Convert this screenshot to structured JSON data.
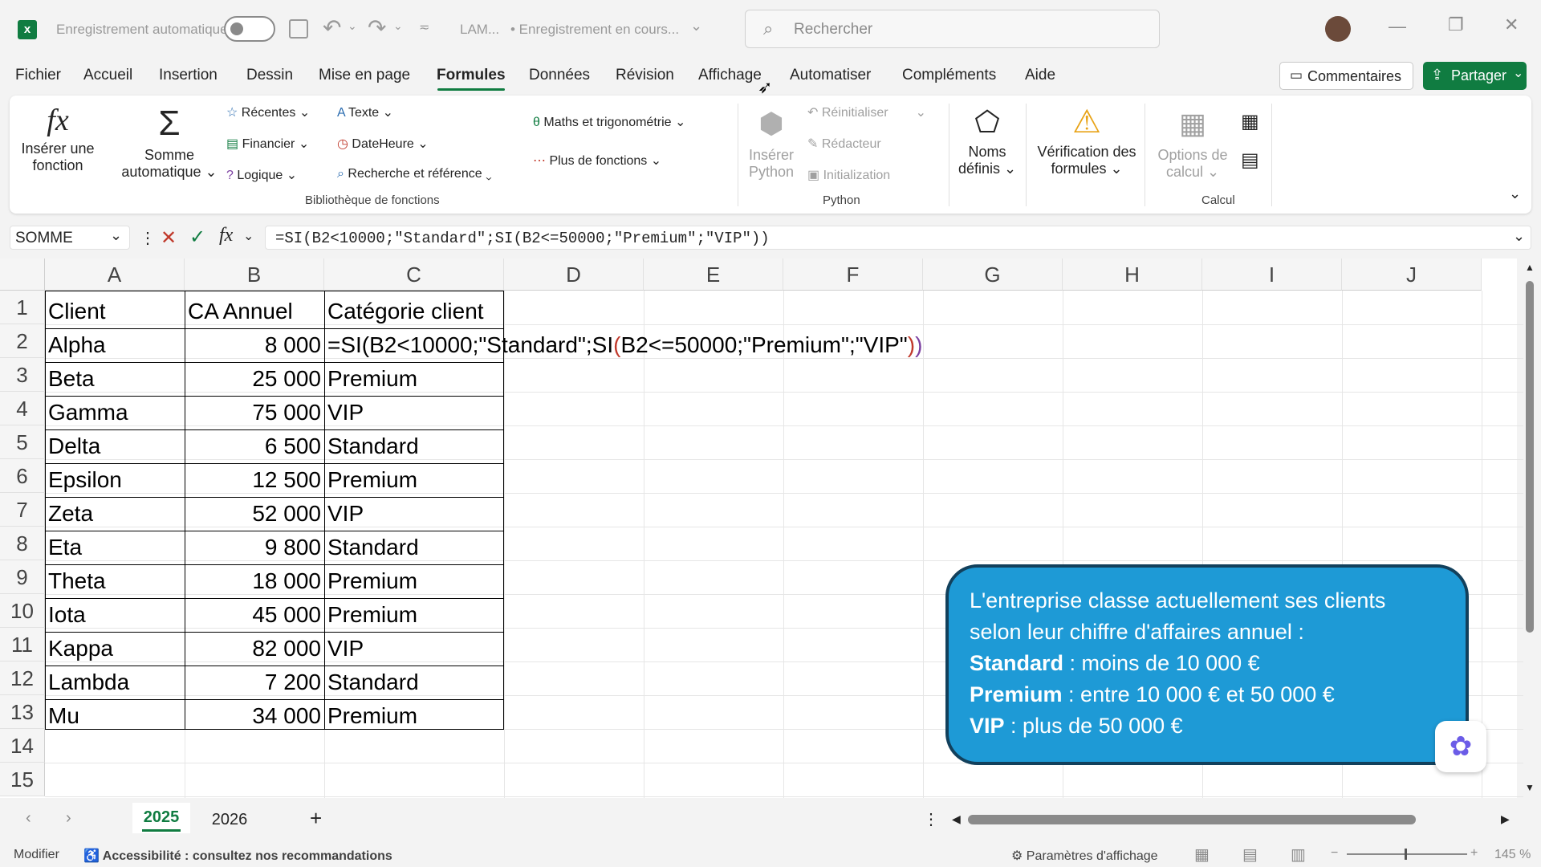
{
  "titlebar": {
    "autosave_label": "Enregistrement automatique",
    "filename": "LAM...",
    "save_status": "• Enregistrement en cours...",
    "search_placeholder": "Rechercher"
  },
  "menu": {
    "items": [
      "Fichier",
      "Accueil",
      "Insertion",
      "Dessin",
      "Mise en page",
      "Formules",
      "Données",
      "Révision",
      "Affichage",
      "Automatiser",
      "Compléments",
      "Aide"
    ],
    "active": "Formules",
    "comments": "Commentaires",
    "share": "Partager"
  },
  "ribbon": {
    "insert_function": [
      "Insérer une",
      "fonction"
    ],
    "autosum": [
      "Somme",
      "automatique"
    ],
    "recent": "Récentes",
    "financial": "Financier",
    "logical": "Logique",
    "text": "Texte",
    "datetime": "DateHeure",
    "lookup": "Recherche et référence",
    "math": "Maths et trigonométrie",
    "more": "Plus de fonctions",
    "library_group": "Bibliothèque de fonctions",
    "insert_python": [
      "Insérer",
      "Python"
    ],
    "reset": "Réinitialiser",
    "editor": "Rédacteur",
    "initialization": "Initialization",
    "python_group": "Python",
    "defined_names": [
      "Noms",
      "définis"
    ],
    "formula_auditing": [
      "Vérification des",
      "formules"
    ],
    "calc_options": [
      "Options de",
      "calcul"
    ],
    "calc_group": "Calcul",
    "colors": {
      "accent": "#107c41"
    }
  },
  "formula_bar": {
    "name_box": "SOMME",
    "formula": "=SI(B2<10000;\"Standard\";SI(B2<=50000;\"Premium\";\"VIP\"))"
  },
  "sheet": {
    "columns": [
      "A",
      "B",
      "C",
      "D",
      "E",
      "F",
      "G",
      "H",
      "I",
      "J"
    ],
    "row_numbers": [
      "1",
      "2",
      "3",
      "4",
      "5",
      "6",
      "7",
      "8",
      "9",
      "10",
      "11",
      "12",
      "13",
      "14",
      "15"
    ],
    "header": [
      "Client",
      "CA Annuel",
      "Catégorie client"
    ],
    "editing_formula": {
      "part1": "=SI(B2<10000;\"Standard\";SI",
      "paren_open": "(",
      "part2": "B2<=50000;\"Premium\";\"VIP\"",
      "paren_close1": ")",
      "paren_close2": ")"
    },
    "rows": [
      [
        "Alpha",
        "8 000",
        ""
      ],
      [
        "Beta",
        "25 000",
        "Premium"
      ],
      [
        "Gamma",
        "75 000",
        "VIP"
      ],
      [
        "Delta",
        "6 500",
        "Standard"
      ],
      [
        "Epsilon",
        "12 500",
        "Premium"
      ],
      [
        "Zeta",
        "52 000",
        "VIP"
      ],
      [
        "Eta",
        "9 800",
        "Standard"
      ],
      [
        "Theta",
        "18 000",
        "Premium"
      ],
      [
        "Iota",
        "45 000",
        "Premium"
      ],
      [
        "Kappa",
        "82 000",
        "VIP"
      ],
      [
        "Lambda",
        "7 200",
        "Standard"
      ],
      [
        "Mu",
        "34 000",
        "Premium"
      ]
    ]
  },
  "callout": {
    "line1": "L'entreprise classe actuellement ses clients",
    "line2": "selon leur chiffre d'affaires annuel :",
    "standard_label": "Standard",
    "standard_text": " : moins de 10 000 €",
    "premium_label": "Premium",
    "premium_text": " : entre 10 000 € et 50 000 €",
    "vip_label": "VIP",
    "vip_text": " : plus de 50 000 €"
  },
  "tabs": {
    "items": [
      "2025",
      "2026"
    ],
    "active": "2025"
  },
  "status": {
    "mode": "Modifier",
    "accessibility": "Accessibilité : consultez nos recommandations",
    "display_settings": "Paramètres d'affichage",
    "zoom": "145 %"
  }
}
